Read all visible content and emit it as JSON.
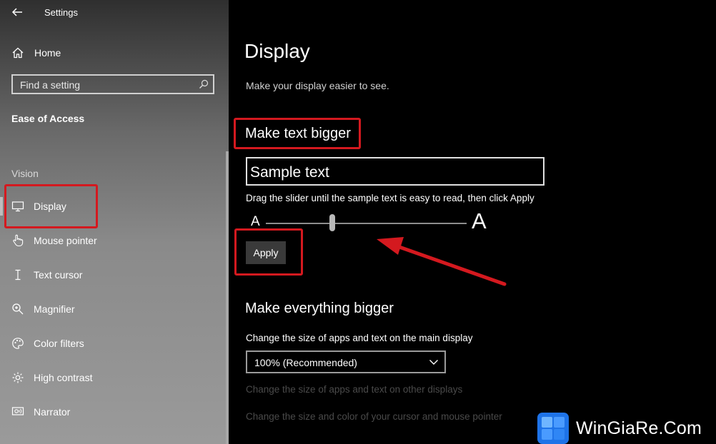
{
  "window": {
    "title": "Settings"
  },
  "sidebar": {
    "home_label": "Home",
    "search_placeholder": "Find a setting",
    "section_title": "Ease of Access",
    "group_label": "Vision",
    "items": [
      {
        "label": "Display",
        "icon": "monitor-icon",
        "selected": true
      },
      {
        "label": "Mouse pointer",
        "icon": "cursor-hand-icon"
      },
      {
        "label": "Text cursor",
        "icon": "text-cursor-icon"
      },
      {
        "label": "Magnifier",
        "icon": "magnifier-icon"
      },
      {
        "label": "Color filters",
        "icon": "palette-icon"
      },
      {
        "label": "High contrast",
        "icon": "high-contrast-icon"
      },
      {
        "label": "Narrator",
        "icon": "narrator-icon"
      }
    ]
  },
  "main": {
    "title": "Display",
    "subtitle": "Make your display easier to see.",
    "text_bigger": {
      "heading": "Make text bigger",
      "sample": "Sample text",
      "instruction": "Drag the slider until the sample text is easy to read, then click Apply",
      "slider_min_label": "A",
      "slider_max_label": "A",
      "slider_value": 0.33,
      "apply_label": "Apply"
    },
    "everything_bigger": {
      "heading": "Make everything bigger",
      "label": "Change the size of apps and text on the main display",
      "selected_value": "100% (Recommended)",
      "link_other_displays": "Change the size of apps and text on other displays",
      "link_cursor": "Change the size and color of your cursor and mouse pointer"
    }
  },
  "annotation_color": "#d4191f",
  "watermark": {
    "text": "WinGiaRe.Com"
  }
}
